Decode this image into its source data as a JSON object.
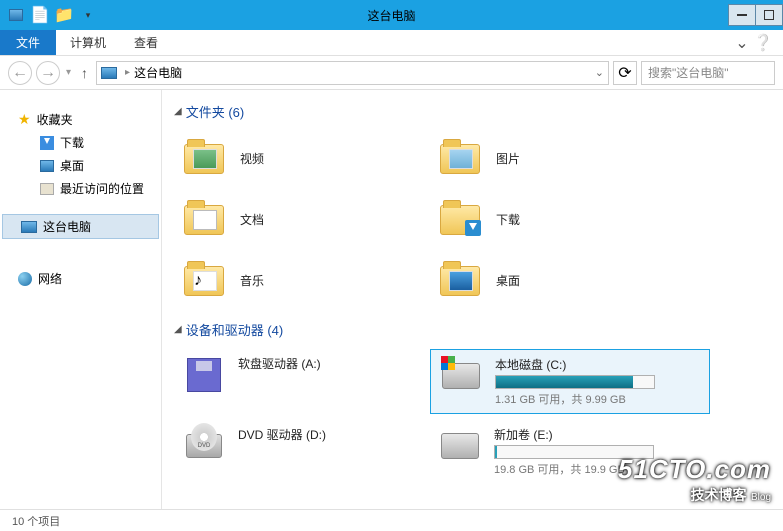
{
  "window": {
    "title": "这台电脑"
  },
  "ribbon": {
    "file": "文件",
    "tabs": [
      "计算机",
      "查看"
    ]
  },
  "navbar": {
    "breadcrumb": "这台电脑",
    "search_placeholder": "搜索\"这台电脑\""
  },
  "sidebar": {
    "favorites": {
      "title": "收藏夹",
      "items": [
        {
          "label": "下载"
        },
        {
          "label": "桌面"
        },
        {
          "label": "最近访问的位置"
        }
      ]
    },
    "this_pc": {
      "label": "这台电脑"
    },
    "network": {
      "label": "网络"
    }
  },
  "content": {
    "folders_header": "文件夹 (6)",
    "folders": [
      {
        "label": "视频"
      },
      {
        "label": "图片"
      },
      {
        "label": "文档"
      },
      {
        "label": "下载"
      },
      {
        "label": "音乐"
      },
      {
        "label": "桌面"
      }
    ],
    "drives_header": "设备和驱动器 (4)",
    "drives": [
      {
        "name": "软盘驱动器 (A:)",
        "sub": ""
      },
      {
        "name": "本地磁盘 (C:)",
        "sub": "1.31 GB 可用，共 9.99 GB",
        "fill": 87,
        "selected": true
      },
      {
        "name": "DVD 驱动器 (D:)",
        "sub": ""
      },
      {
        "name": "新加卷 (E:)",
        "sub": "19.8 GB 可用，共 19.9 GB",
        "fill": 1
      }
    ]
  },
  "statusbar": {
    "text": "10 个项目"
  },
  "watermark": {
    "big": "51CTO.com",
    "small": "技术博客",
    "blog": "Blog"
  }
}
